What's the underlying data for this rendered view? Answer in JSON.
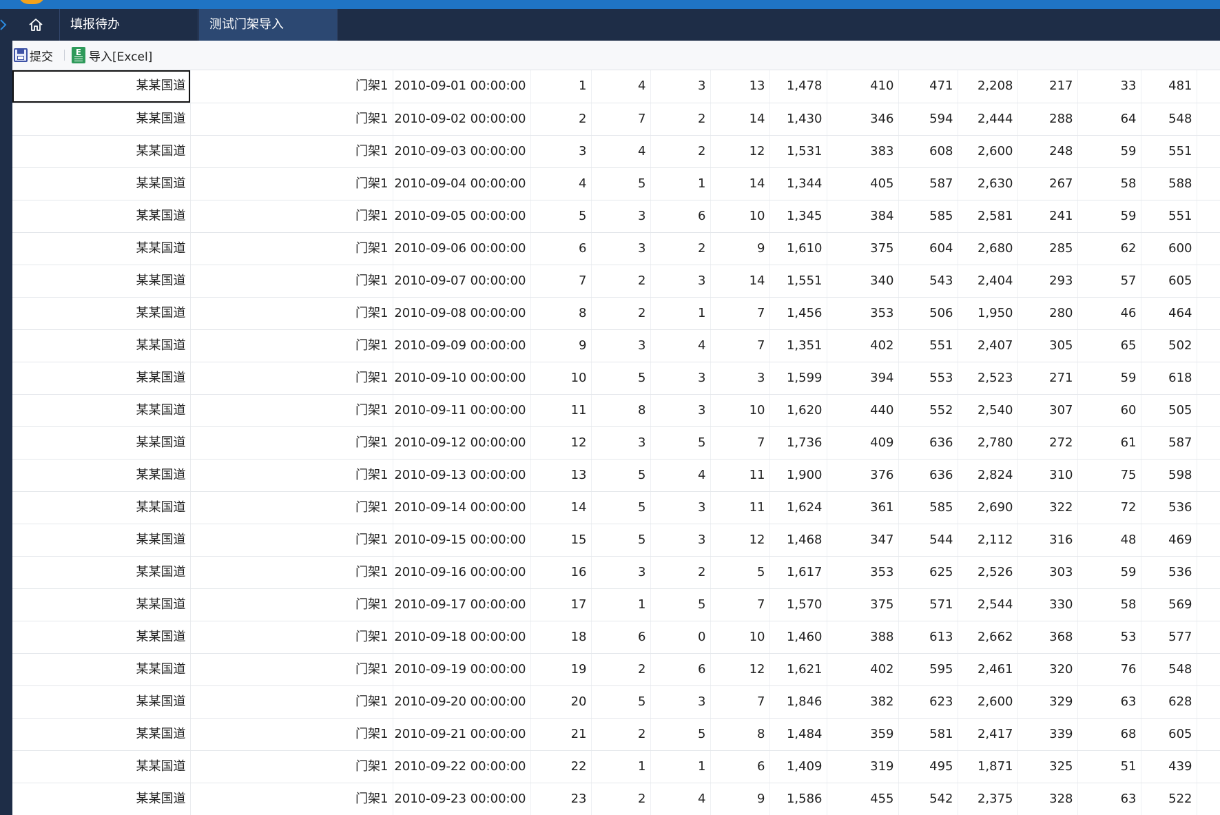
{
  "tabs": {
    "home_icon": "home-icon",
    "items": [
      {
        "label": "填报待办",
        "active": false
      },
      {
        "label": "测试门架导入",
        "active": true
      }
    ]
  },
  "toolbar": {
    "submit_label": "提交",
    "import_label": "导入[Excel]"
  },
  "table": {
    "rows": [
      [
        "某某国道",
        "门架1",
        "2010-09-01 00:00:00",
        "1",
        "4",
        "3",
        "13",
        "1,478",
        "410",
        "471",
        "2,208",
        "217",
        "33",
        "481"
      ],
      [
        "某某国道",
        "门架1",
        "2010-09-02 00:00:00",
        "2",
        "7",
        "2",
        "14",
        "1,430",
        "346",
        "594",
        "2,444",
        "288",
        "64",
        "548"
      ],
      [
        "某某国道",
        "门架1",
        "2010-09-03 00:00:00",
        "3",
        "4",
        "2",
        "12",
        "1,531",
        "383",
        "608",
        "2,600",
        "248",
        "59",
        "551"
      ],
      [
        "某某国道",
        "门架1",
        "2010-09-04 00:00:00",
        "4",
        "5",
        "1",
        "14",
        "1,344",
        "405",
        "587",
        "2,630",
        "267",
        "58",
        "588"
      ],
      [
        "某某国道",
        "门架1",
        "2010-09-05 00:00:00",
        "5",
        "3",
        "6",
        "10",
        "1,345",
        "384",
        "585",
        "2,581",
        "241",
        "59",
        "551"
      ],
      [
        "某某国道",
        "门架1",
        "2010-09-06 00:00:00",
        "6",
        "3",
        "2",
        "9",
        "1,610",
        "375",
        "604",
        "2,680",
        "285",
        "62",
        "600"
      ],
      [
        "某某国道",
        "门架1",
        "2010-09-07 00:00:00",
        "7",
        "2",
        "3",
        "14",
        "1,551",
        "340",
        "543",
        "2,404",
        "293",
        "57",
        "605"
      ],
      [
        "某某国道",
        "门架1",
        "2010-09-08 00:00:00",
        "8",
        "2",
        "1",
        "7",
        "1,456",
        "353",
        "506",
        "1,950",
        "280",
        "46",
        "464"
      ],
      [
        "某某国道",
        "门架1",
        "2010-09-09 00:00:00",
        "9",
        "3",
        "4",
        "7",
        "1,351",
        "402",
        "551",
        "2,407",
        "305",
        "65",
        "502"
      ],
      [
        "某某国道",
        "门架1",
        "2010-09-10 00:00:00",
        "10",
        "5",
        "3",
        "3",
        "1,599",
        "394",
        "553",
        "2,523",
        "271",
        "59",
        "618"
      ],
      [
        "某某国道",
        "门架1",
        "2010-09-11 00:00:00",
        "11",
        "8",
        "3",
        "10",
        "1,620",
        "440",
        "552",
        "2,540",
        "307",
        "60",
        "505"
      ],
      [
        "某某国道",
        "门架1",
        "2010-09-12 00:00:00",
        "12",
        "3",
        "5",
        "7",
        "1,736",
        "409",
        "636",
        "2,780",
        "272",
        "61",
        "587"
      ],
      [
        "某某国道",
        "门架1",
        "2010-09-13 00:00:00",
        "13",
        "5",
        "4",
        "11",
        "1,900",
        "376",
        "636",
        "2,824",
        "310",
        "75",
        "598"
      ],
      [
        "某某国道",
        "门架1",
        "2010-09-14 00:00:00",
        "14",
        "5",
        "3",
        "11",
        "1,624",
        "361",
        "585",
        "2,690",
        "322",
        "72",
        "536"
      ],
      [
        "某某国道",
        "门架1",
        "2010-09-15 00:00:00",
        "15",
        "5",
        "3",
        "12",
        "1,468",
        "347",
        "544",
        "2,112",
        "316",
        "48",
        "469"
      ],
      [
        "某某国道",
        "门架1",
        "2010-09-16 00:00:00",
        "16",
        "3",
        "2",
        "5",
        "1,617",
        "353",
        "625",
        "2,526",
        "303",
        "59",
        "536"
      ],
      [
        "某某国道",
        "门架1",
        "2010-09-17 00:00:00",
        "17",
        "1",
        "5",
        "7",
        "1,570",
        "375",
        "571",
        "2,544",
        "330",
        "58",
        "569"
      ],
      [
        "某某国道",
        "门架1",
        "2010-09-18 00:00:00",
        "18",
        "6",
        "0",
        "10",
        "1,460",
        "388",
        "613",
        "2,662",
        "368",
        "53",
        "577"
      ],
      [
        "某某国道",
        "门架1",
        "2010-09-19 00:00:00",
        "19",
        "2",
        "6",
        "12",
        "1,621",
        "402",
        "595",
        "2,461",
        "320",
        "76",
        "548"
      ],
      [
        "某某国道",
        "门架1",
        "2010-09-20 00:00:00",
        "20",
        "5",
        "3",
        "7",
        "1,846",
        "382",
        "623",
        "2,600",
        "329",
        "63",
        "628"
      ],
      [
        "某某国道",
        "门架1",
        "2010-09-21 00:00:00",
        "21",
        "2",
        "5",
        "8",
        "1,484",
        "359",
        "581",
        "2,417",
        "339",
        "68",
        "605"
      ],
      [
        "某某国道",
        "门架1",
        "2010-09-22 00:00:00",
        "22",
        "1",
        "1",
        "6",
        "1,409",
        "319",
        "495",
        "1,871",
        "325",
        "51",
        "439"
      ],
      [
        "某某国道",
        "门架1",
        "2010-09-23 00:00:00",
        "23",
        "2",
        "4",
        "9",
        "1,586",
        "455",
        "542",
        "2,375",
        "328",
        "63",
        "522"
      ]
    ]
  }
}
